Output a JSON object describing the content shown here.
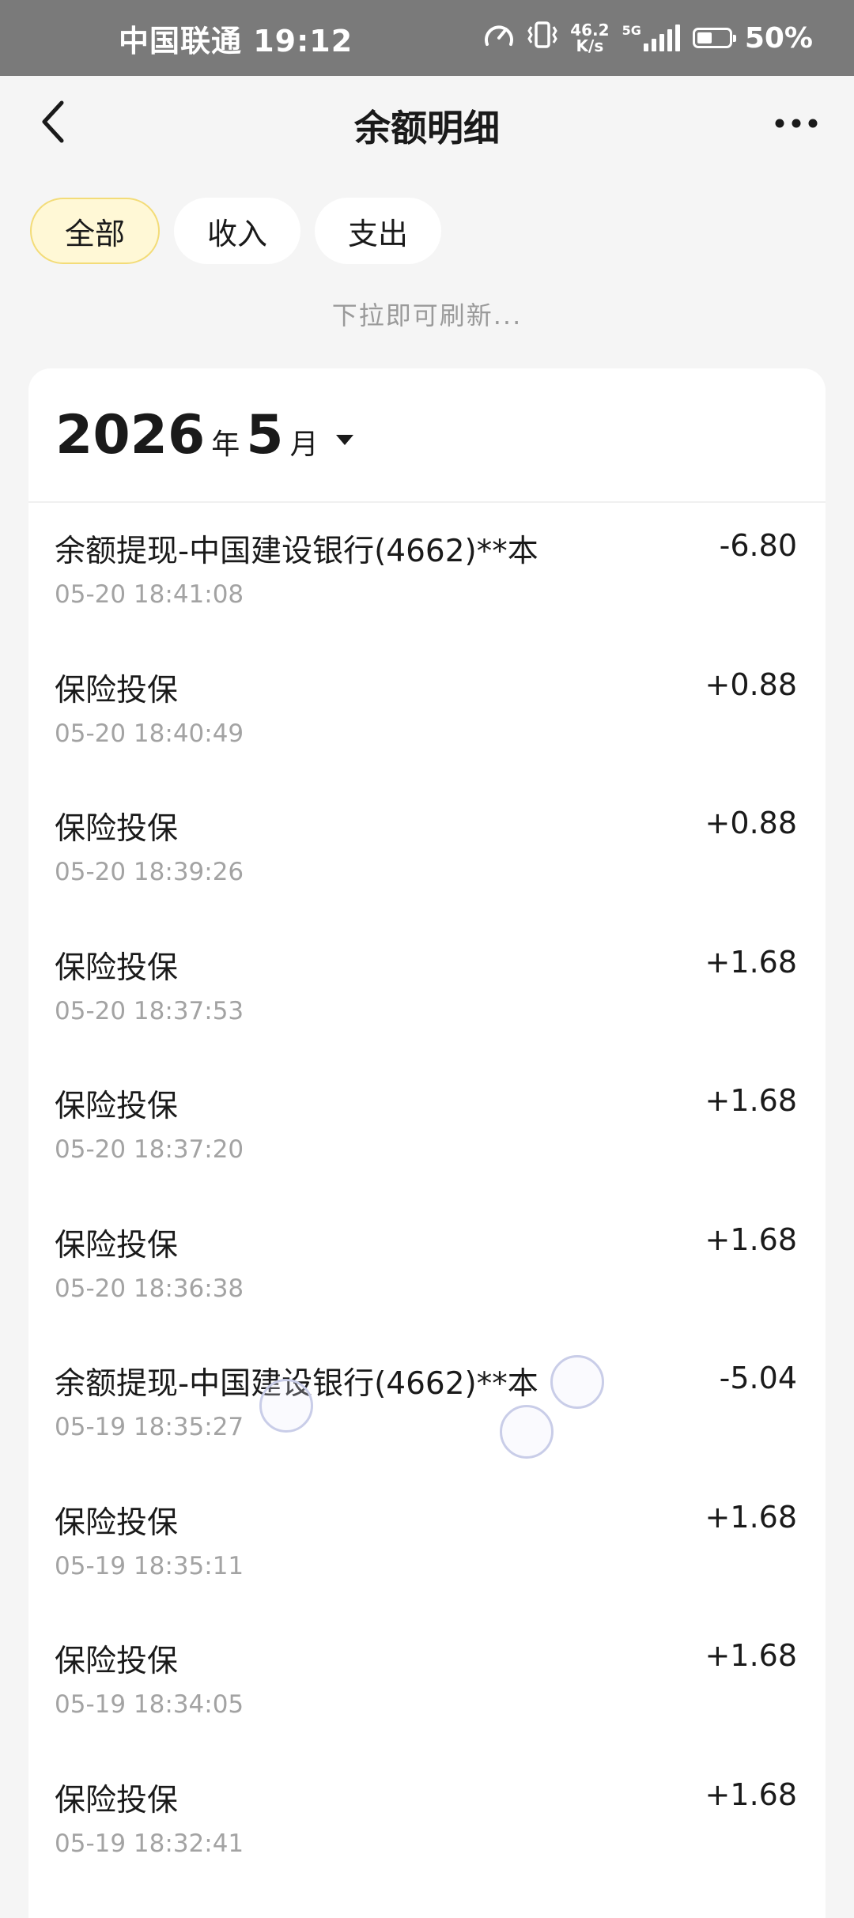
{
  "status_bar": {
    "carrier_time": "中国联通 19:12",
    "speed_value": "46.2",
    "speed_unit": "K/s",
    "network": "5G",
    "battery": "50%",
    "icons": [
      "speedometer-icon",
      "vibrate-icon",
      "signal-icon",
      "battery-icon"
    ]
  },
  "nav": {
    "title": "余额明细",
    "back_icon": "chevron-left-icon",
    "more_icon": "more-dots-icon"
  },
  "filters": [
    {
      "label": "全部",
      "active": true
    },
    {
      "label": "收入",
      "active": false
    },
    {
      "label": "支出",
      "active": false
    }
  ],
  "refresh_hint": "下拉即可刷新...",
  "month": {
    "year": "2026",
    "year_unit": "年",
    "month": "5",
    "month_unit": "月"
  },
  "transactions": [
    {
      "title": "余额提现-中国建设银行(4662)**本",
      "time": "05-20 18:41:08",
      "amount": "-6.80"
    },
    {
      "title": "保险投保",
      "time": "05-20 18:40:49",
      "amount": "+0.88"
    },
    {
      "title": "保险投保",
      "time": "05-20 18:39:26",
      "amount": "+0.88"
    },
    {
      "title": "保险投保",
      "time": "05-20 18:37:53",
      "amount": "+1.68"
    },
    {
      "title": "保险投保",
      "time": "05-20 18:37:20",
      "amount": "+1.68"
    },
    {
      "title": "保险投保",
      "time": "05-20 18:36:38",
      "amount": "+1.68"
    },
    {
      "title": "余额提现-中国建设银行(4662)**本",
      "time": "05-19 18:35:27",
      "amount": "-5.04"
    },
    {
      "title": "保险投保",
      "time": "05-19 18:35:11",
      "amount": "+1.68"
    },
    {
      "title": "保险投保",
      "time": "05-19 18:34:05",
      "amount": "+1.68"
    },
    {
      "title": "保险投保",
      "time": "05-19 18:32:41",
      "amount": "+1.68"
    }
  ],
  "colors": {
    "active_tab_bg": "#fff8d6",
    "active_tab_border": "#f3dc78",
    "status_bar_bg": "#7a7a7a"
  }
}
